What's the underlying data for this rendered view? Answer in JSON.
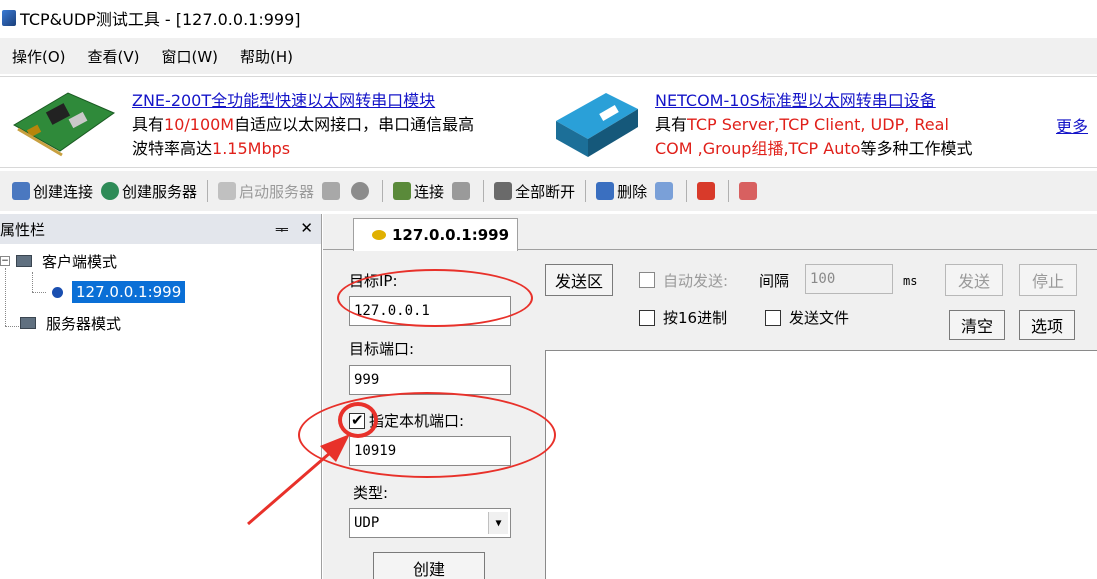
{
  "window": {
    "title": "TCP&UDP测试工具 - [127.0.0.1:999]"
  },
  "menu": [
    "操作(O)",
    "查看(V)",
    "窗口(W)",
    "帮助(H)"
  ],
  "ads": {
    "ad1_title": "ZNE-200T全功能型快速以太网转串口模块",
    "ad1_l1_a": "具有",
    "ad1_l1_b": "10/100M",
    "ad1_l1_c": "自适应以太网接口，串口通信最高",
    "ad1_l2_a": "波特率高达",
    "ad1_l2_b": "1.15Mbps",
    "ad2_title": "NETCOM-10S标准型以太网转串口设备",
    "ad2_l1_a": "具有",
    "ad2_l1_b": "TCP Server,TCP Client, UDP, Real",
    "ad2_l2_a": "COM ,Group组播,TCP Auto",
    "ad2_l2_b": "等多种工作模式",
    "more": "更多"
  },
  "toolbar": {
    "create_connection": "创建连接",
    "create_server": "创建服务器",
    "start_server": "启动服务器",
    "connect": "连接",
    "disconnect_all": "全部断开",
    "delete": "删除"
  },
  "properties": {
    "title": "属性栏",
    "pin": "ᆍ",
    "close": "✕",
    "client_mode": "客户端模式",
    "client_item": "127.0.0.1:999",
    "server_mode": "服务器模式"
  },
  "tab": {
    "label": "127.0.0.1:999"
  },
  "form": {
    "target_ip_label": "目标IP:",
    "target_ip_value": "127.0.0.1",
    "target_port_label": "目标端口:",
    "target_port_value": "999",
    "local_port_label": "指定本机端口:",
    "local_port_checked": true,
    "local_port_value": "10919",
    "type_label": "类型:",
    "type_value": "UDP",
    "create_button": "创建"
  },
  "send": {
    "send_area_button": "发送区",
    "auto_send_label": "自动发送:",
    "interval_label": "间隔",
    "interval_value": "100",
    "ms_label": "ms",
    "send_button": "发送",
    "stop_button": "停止",
    "hex_label": "按16进制",
    "send_file_label": "发送文件",
    "clear_button": "清空",
    "options_button": "选项"
  }
}
